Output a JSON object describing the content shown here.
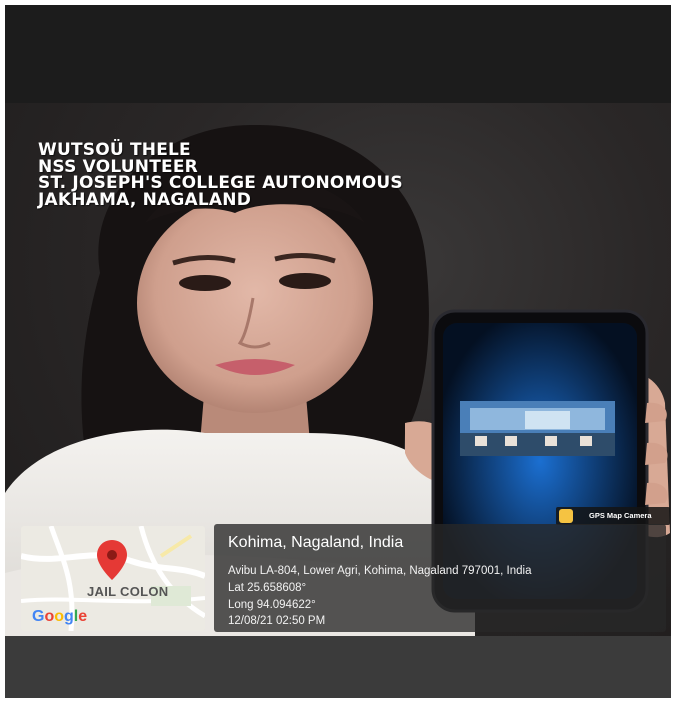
{
  "caption": {
    "line1": "WUTSOÜ THELE",
    "line2": "NSS VOLUNTEER",
    "line3": "ST. JOSEPH'S COLLEGE AUTONOMOUS",
    "line4": "JAKHAMA, NAGALAND"
  },
  "badge": {
    "label": "GPS Map Camera",
    "icon": "gps-map-camera-icon"
  },
  "map": {
    "place_label": "JAIL COLON",
    "brand": "Google",
    "pin_color": "#e53935"
  },
  "location": {
    "title": "Kohima, Nagaland, India",
    "address": "Avibu LA-804, Lower Agri, Kohima, Nagaland 797001, India",
    "lat": "Lat 25.658608°",
    "long": "Long 94.094622°",
    "datetime": "12/08/21 02:50 PM"
  }
}
